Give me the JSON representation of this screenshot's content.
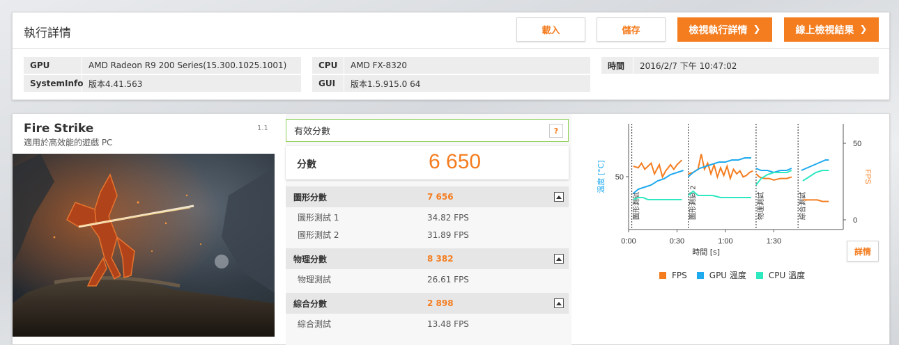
{
  "header": {
    "title": "執行詳情",
    "load_label": "載入",
    "save_label": "儲存",
    "view_details_label": "檢視執行詳情",
    "view_online_label": "線上檢視結果"
  },
  "system": {
    "gpu_label": "GPU",
    "gpu_value": "AMD Radeon R9 200 Series(15.300.1025.1001)",
    "sysinfo_label": "SystemInfo",
    "sysinfo_value": "版本4.41.563",
    "cpu_label": "CPU",
    "cpu_value": "AMD FX-8320",
    "gui_label": "GUI",
    "gui_value": "版本1.5.915.0 64",
    "time_label": "時間",
    "time_value": "2016/2/7 下午 10:47:02"
  },
  "test": {
    "name": "Fire Strike",
    "subtitle": "適用於高效能的遊戲 PC",
    "version": "1.1"
  },
  "results": {
    "valid_label": "有效分數",
    "help_label": "?",
    "score_label": "分數",
    "score_value": "6 650",
    "graphics": {
      "label": "圖形分數",
      "value": "7 656",
      "tests": [
        {
          "label": "圖形測試 1",
          "value": "34.82 FPS"
        },
        {
          "label": "圖形測試 2",
          "value": "31.89 FPS"
        }
      ]
    },
    "physics": {
      "label": "物理分數",
      "value": "8 382",
      "tests": [
        {
          "label": "物理測試",
          "value": "26.61 FPS"
        }
      ]
    },
    "combined": {
      "label": "綜合分數",
      "value": "2 898",
      "tests": [
        {
          "label": "綜合測試",
          "value": "13.48 FPS"
        }
      ]
    }
  },
  "chart_data": {
    "type": "line",
    "xlabel": "時間 [s]",
    "ylabel_left": "溫度 [°C]",
    "ylabel_right": "FPS",
    "x_ticks": [
      "0:00",
      "0:30",
      "1:00",
      "1:30"
    ],
    "y_left_ticks": [
      "50"
    ],
    "y_right_ticks": [
      "50",
      "0"
    ],
    "ylim_right": [
      0,
      50
    ],
    "segments": [
      "圖形測試",
      "圖形測試 2",
      "物理測試",
      "綜合測試"
    ],
    "segment_bounds_s": [
      [
        2,
        34
      ],
      [
        37,
        77
      ],
      [
        79,
        103
      ],
      [
        105,
        124
      ]
    ],
    "series": [
      {
        "name": "FPS",
        "color": "#f47d20",
        "axis": "right",
        "points": [
          [
            3,
            35
          ],
          [
            6,
            34
          ],
          [
            8,
            37
          ],
          [
            10,
            33
          ],
          [
            12,
            35
          ],
          [
            14,
            37
          ],
          [
            16,
            30
          ],
          [
            19,
            36
          ],
          [
            21,
            28
          ],
          [
            23,
            32
          ],
          [
            26,
            36
          ],
          [
            28,
            33
          ],
          [
            30,
            36
          ],
          [
            33,
            39
          ],
          [
            37,
            30
          ],
          [
            40,
            31
          ],
          [
            43,
            33
          ],
          [
            45,
            43
          ],
          [
            47,
            33
          ],
          [
            49,
            37
          ],
          [
            51,
            30
          ],
          [
            53,
            36
          ],
          [
            55,
            28
          ],
          [
            57,
            34
          ],
          [
            59,
            29
          ],
          [
            61,
            35
          ],
          [
            63,
            27
          ],
          [
            65,
            33
          ],
          [
            67,
            30
          ],
          [
            69,
            32
          ],
          [
            71,
            28
          ],
          [
            73,
            29
          ],
          [
            75,
            31
          ],
          [
            77,
            32
          ],
          [
            79,
            30
          ],
          [
            81,
            28
          ],
          [
            84,
            27
          ],
          [
            87,
            27
          ],
          [
            90,
            26
          ],
          [
            94,
            27
          ],
          [
            98,
            27
          ],
          [
            101,
            28
          ],
          [
            104,
            13
          ],
          [
            108,
            13
          ],
          [
            111,
            13
          ],
          [
            114,
            13
          ],
          [
            117,
            13
          ],
          [
            120,
            12
          ],
          [
            124,
            12
          ]
        ]
      },
      {
        "name": "GPU 溫度",
        "color": "#1fa9ee",
        "axis": "left",
        "points": [
          [
            3,
            42
          ],
          [
            6,
            44
          ],
          [
            10,
            45
          ],
          [
            14,
            46
          ],
          [
            18,
            48
          ],
          [
            22,
            49
          ],
          [
            26,
            51
          ],
          [
            30,
            52
          ],
          [
            34,
            53
          ],
          [
            37,
            50
          ],
          [
            40,
            52
          ],
          [
            44,
            54
          ],
          [
            48,
            55
          ],
          [
            52,
            56
          ],
          [
            56,
            57
          ],
          [
            60,
            57
          ],
          [
            64,
            58
          ],
          [
            68,
            58
          ],
          [
            72,
            59
          ],
          [
            76,
            59
          ],
          [
            79,
            54
          ],
          [
            82,
            53
          ],
          [
            86,
            53
          ],
          [
            90,
            52
          ],
          [
            94,
            53
          ],
          [
            98,
            53
          ],
          [
            101,
            54
          ],
          [
            104,
            50
          ],
          [
            107,
            53
          ],
          [
            110,
            54
          ],
          [
            113,
            55
          ],
          [
            116,
            56
          ],
          [
            119,
            57
          ],
          [
            122,
            58
          ],
          [
            124,
            58
          ]
        ]
      },
      {
        "name": "CPU 溫度",
        "color": "#2ee8c0",
        "axis": "left",
        "points": [
          [
            3,
            39
          ],
          [
            6,
            40
          ],
          [
            9,
            40
          ],
          [
            12,
            39
          ],
          [
            16,
            39
          ],
          [
            20,
            39
          ],
          [
            24,
            39
          ],
          [
            28,
            39
          ],
          [
            33,
            39
          ],
          [
            37,
            41
          ],
          [
            40,
            43
          ],
          [
            43,
            41
          ],
          [
            47,
            41
          ],
          [
            52,
            41
          ],
          [
            57,
            40
          ],
          [
            62,
            40
          ],
          [
            67,
            40
          ],
          [
            72,
            40
          ],
          [
            76,
            40
          ],
          [
            79,
            46
          ],
          [
            82,
            49
          ],
          [
            86,
            51
          ],
          [
            90,
            52
          ],
          [
            94,
            52
          ],
          [
            98,
            52
          ],
          [
            101,
            53
          ],
          [
            104,
            46
          ],
          [
            108,
            48
          ],
          [
            112,
            50
          ],
          [
            116,
            52
          ],
          [
            120,
            53
          ],
          [
            124,
            53
          ]
        ]
      }
    ],
    "legend_position": "bottom",
    "detail_button_label": "詳情"
  }
}
